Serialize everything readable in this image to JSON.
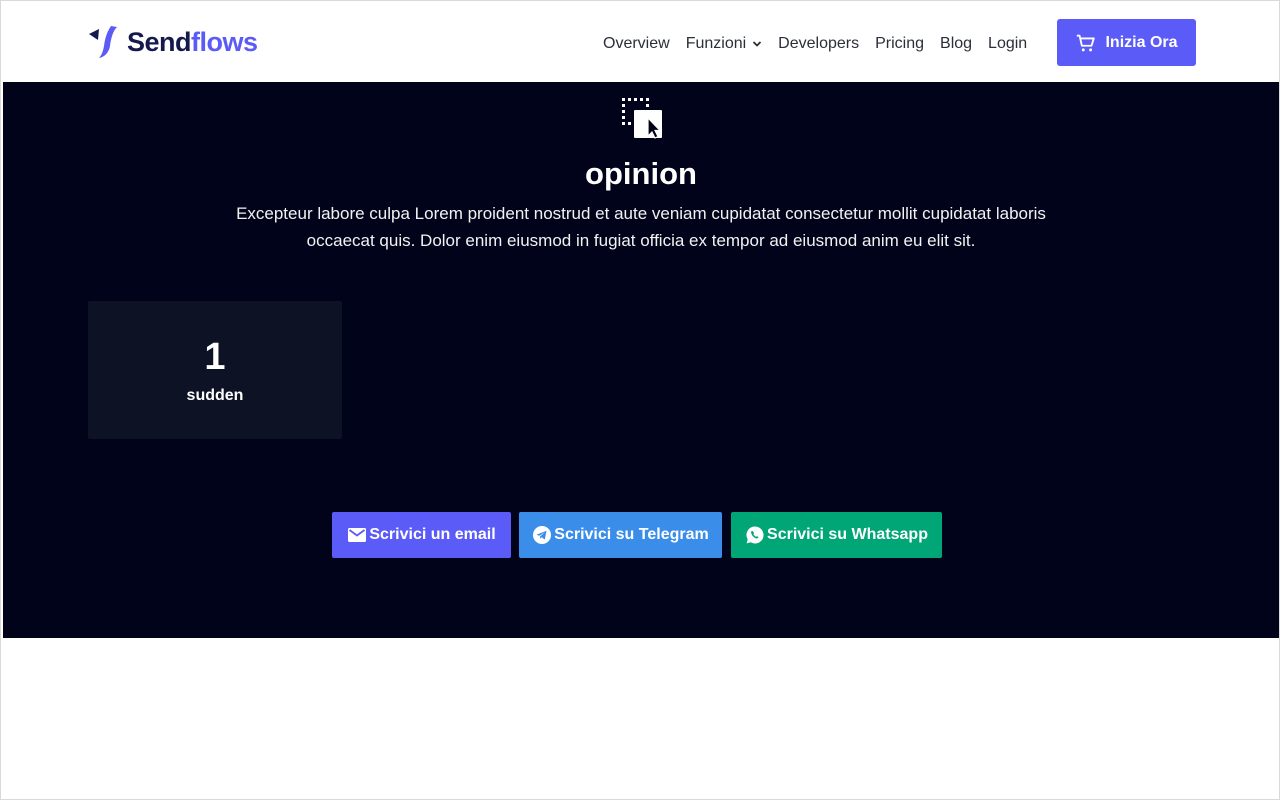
{
  "header": {
    "logo": {
      "part1": "Send",
      "part2": "flows",
      "icon": "sendflows-logo-icon"
    },
    "nav": [
      {
        "label": "Overview"
      },
      {
        "label": "Funzioni",
        "icon": "chevron-down-icon"
      },
      {
        "label": "Developers"
      },
      {
        "label": "Pricing"
      },
      {
        "label": "Blog"
      },
      {
        "label": "Login"
      }
    ],
    "cta": {
      "label": "Inizia Ora",
      "icon": "cart-icon"
    }
  },
  "hero": {
    "icon": "select-cursor-icon",
    "title": "opinion",
    "description": "Excepteur labore culpa Lorem proident nostrud et aute veniam cupidatat consectetur mollit cupidatat laboris occaecat quis. Dolor enim eiusmod in fugiat officia ex tempor ad eiusmod anim eu elit sit."
  },
  "stats": [
    {
      "value": "1",
      "label": "sudden"
    }
  ],
  "contact": {
    "email": {
      "label": "Scrivici un email",
      "icon": "mail-icon"
    },
    "telegram": {
      "label": "Scrivici su Telegram",
      "icon": "telegram-icon"
    },
    "whatsapp": {
      "label": "Scrivici su Whatsapp",
      "icon": "whatsapp-icon"
    }
  },
  "colors": {
    "brand": "#5b5bf7",
    "dark_bg": "#00031a",
    "card_bg": "#0d1224",
    "telegram": "#3a8eea",
    "whatsapp": "#00a676"
  }
}
